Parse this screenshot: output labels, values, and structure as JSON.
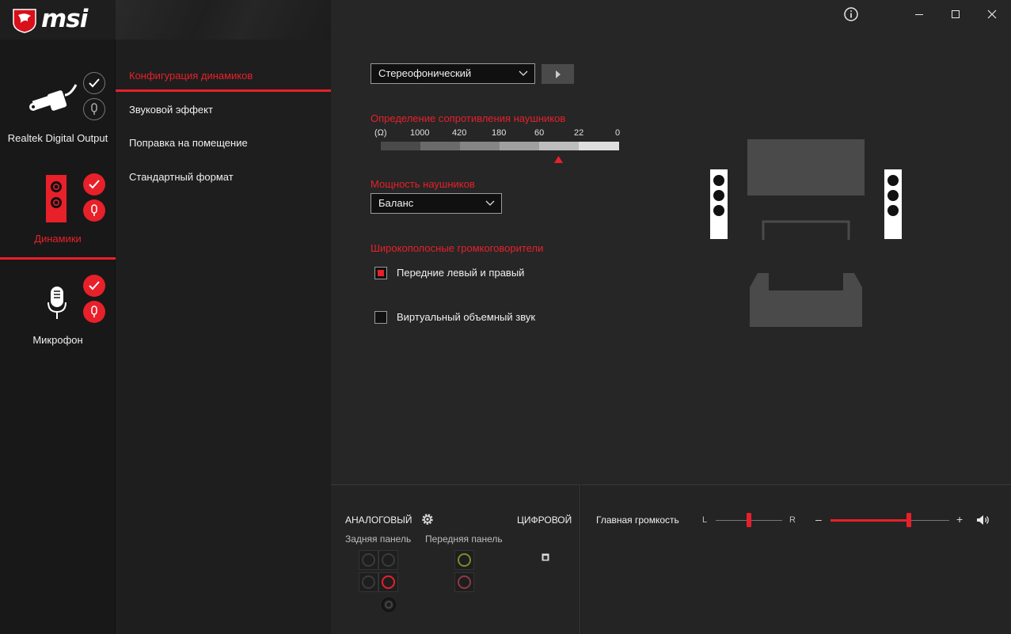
{
  "window": {
    "brand": "msi",
    "info_icon": "info-icon",
    "controls": [
      "minimize-icon",
      "maximize-icon",
      "close-icon"
    ]
  },
  "devices": [
    {
      "label": "Realtek Digital Output",
      "icon": "digital-output-plug-icon",
      "status": [
        "check-outline-icon",
        "mic-outline-icon"
      ],
      "active": false
    },
    {
      "label": "Динамики",
      "icon": "speaker-icon",
      "status": [
        "check-red-icon",
        "mic-red-icon"
      ],
      "active": true
    },
    {
      "label": "Микрофон",
      "icon": "microphone-icon",
      "status": [
        "check-red-icon",
        "mic-red-icon"
      ],
      "active": false
    }
  ],
  "subnav": {
    "items": [
      {
        "label": "Конфигурация динамиков",
        "active": true
      },
      {
        "label": "Звуковой эффект",
        "active": false
      },
      {
        "label": "Поправка на помещение",
        "active": false
      },
      {
        "label": "Стандартный формат",
        "active": false
      }
    ]
  },
  "speaker_config": {
    "mode_select": "Стереофонический",
    "play_icon": "play-icon",
    "impedance_title": "Определение сопротивления наушников",
    "impedance_ticks": [
      "(Ω)",
      "1000",
      "420",
      "180",
      "60",
      "22",
      "0"
    ],
    "headphone_power_title": "Мощность наушников",
    "headphone_power_select": "Баланс",
    "fullrange_title": "Широкополосные громкоговорители",
    "fullrange_front_label": "Передние левый и правый",
    "fullrange_front_checked": true,
    "virtual_surround_label": "Виртуальный объемный звук",
    "virtual_surround_checked": false
  },
  "connectors": {
    "analog_label": "АНАЛОГОВЫЙ",
    "digital_label": "ЦИФРОВОЙ",
    "rear_panel_label": "Задняя панель",
    "front_panel_label": "Передняя панель",
    "settings_icon": "gear-icon"
  },
  "volume": {
    "label": "Главная громкость",
    "balance_left": "L",
    "balance_right": "R",
    "minus": "–",
    "plus": "+",
    "balance_value": 0.5,
    "volume_value": 0.66,
    "speaker_icon": "volume-icon"
  },
  "colors": {
    "accent": "#e8202a",
    "background": "#262626"
  }
}
